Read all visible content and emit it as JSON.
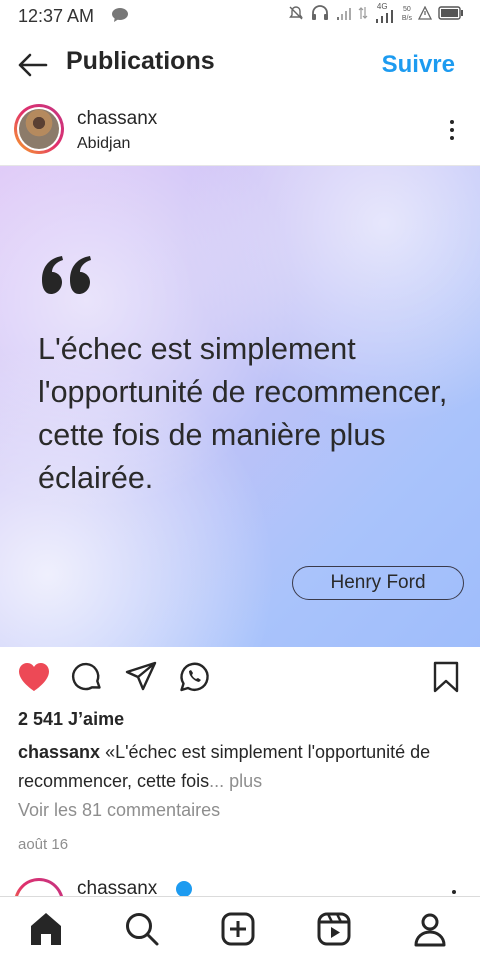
{
  "status_bar": {
    "time": "12:37 AM",
    "network_label": "4G",
    "speed_value": "50",
    "speed_unit": "B/s"
  },
  "header": {
    "title": "Publications",
    "follow_label": "Suivre"
  },
  "post": {
    "username": "chassanx",
    "location": "Abidjan",
    "image": {
      "quote": "L'échec est simplement l'opportunité de recommencer, cette fois de manière plus éclairée.",
      "author": "Henry Ford"
    },
    "likes": "2 541 J’aime",
    "caption_user": "chassanx",
    "caption_text": "«L'échec est simplement l'opportunité de recommencer, cette fois",
    "caption_more": "... plus",
    "comments_link": "Voir les 81 commentaires",
    "date": "août 16"
  },
  "next_post": {
    "username": "chassanx"
  },
  "colors": {
    "accent": "#1d9bf0",
    "like": "#ed4956",
    "text": "#262626",
    "muted": "#8e8e8e"
  },
  "icons": {
    "status_left": "chat-bubble-icon",
    "status_right": [
      "mute-bell-icon",
      "headphones-icon",
      "signal-icon",
      "data-arrows-icon",
      "signal-4g-icon",
      "alert-icon",
      "battery-icon"
    ],
    "actions": [
      "heart-filled-icon",
      "comment-icon",
      "share-icon",
      "whatsapp-icon",
      "bookmark-icon"
    ],
    "nav": [
      "home-icon",
      "search-icon",
      "create-icon",
      "reels-icon",
      "profile-icon"
    ]
  }
}
